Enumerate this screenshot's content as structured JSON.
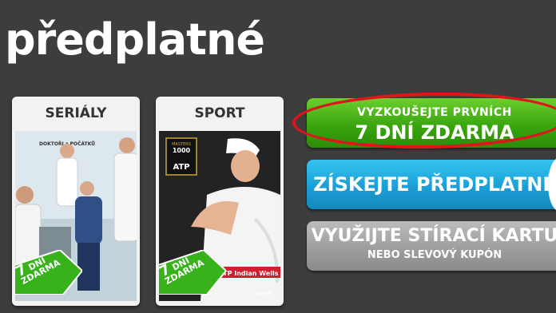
{
  "page": {
    "title": "předplatné"
  },
  "cards": [
    {
      "title": "SERIÁLY",
      "poster_caption": "DOKTOŘI z POČÁTKŮ",
      "banner": {
        "number": "7",
        "line1": "DNÍ",
        "line2": "ZDARMA"
      }
    },
    {
      "title": "SPORT",
      "poster_badge_top": "MASTERS",
      "poster_badge_num": "1000",
      "poster_badge_brand": "ATP",
      "poster_caption": "ATP Indian Wells",
      "footer_left": "VOYO",
      "footer_right": "sport",
      "banner": {
        "number": "7",
        "line1": "DNÍ",
        "line2": "ZDARMA"
      }
    }
  ],
  "buttons": {
    "trial": {
      "line1": "VYZKOUŠEJTE PRVNÍCH",
      "line2": "7 DNÍ ZDARMA"
    },
    "subscribe": {
      "label": "ZÍSKEJTE PŘEDPLATNÉ"
    },
    "voucher": {
      "line1": "VYUŽIJTE STÍRACÍ KARTU",
      "line2": "NEBO SLEVOVÝ KUPÓN"
    }
  },
  "colors": {
    "background": "#3d3d3d",
    "trial_green": "#3aa60f",
    "subscribe_blue": "#1a9fd6",
    "voucher_gray": "#9e9e9e",
    "highlight_red": "#e0141c",
    "banner_green": "#38b21a"
  }
}
